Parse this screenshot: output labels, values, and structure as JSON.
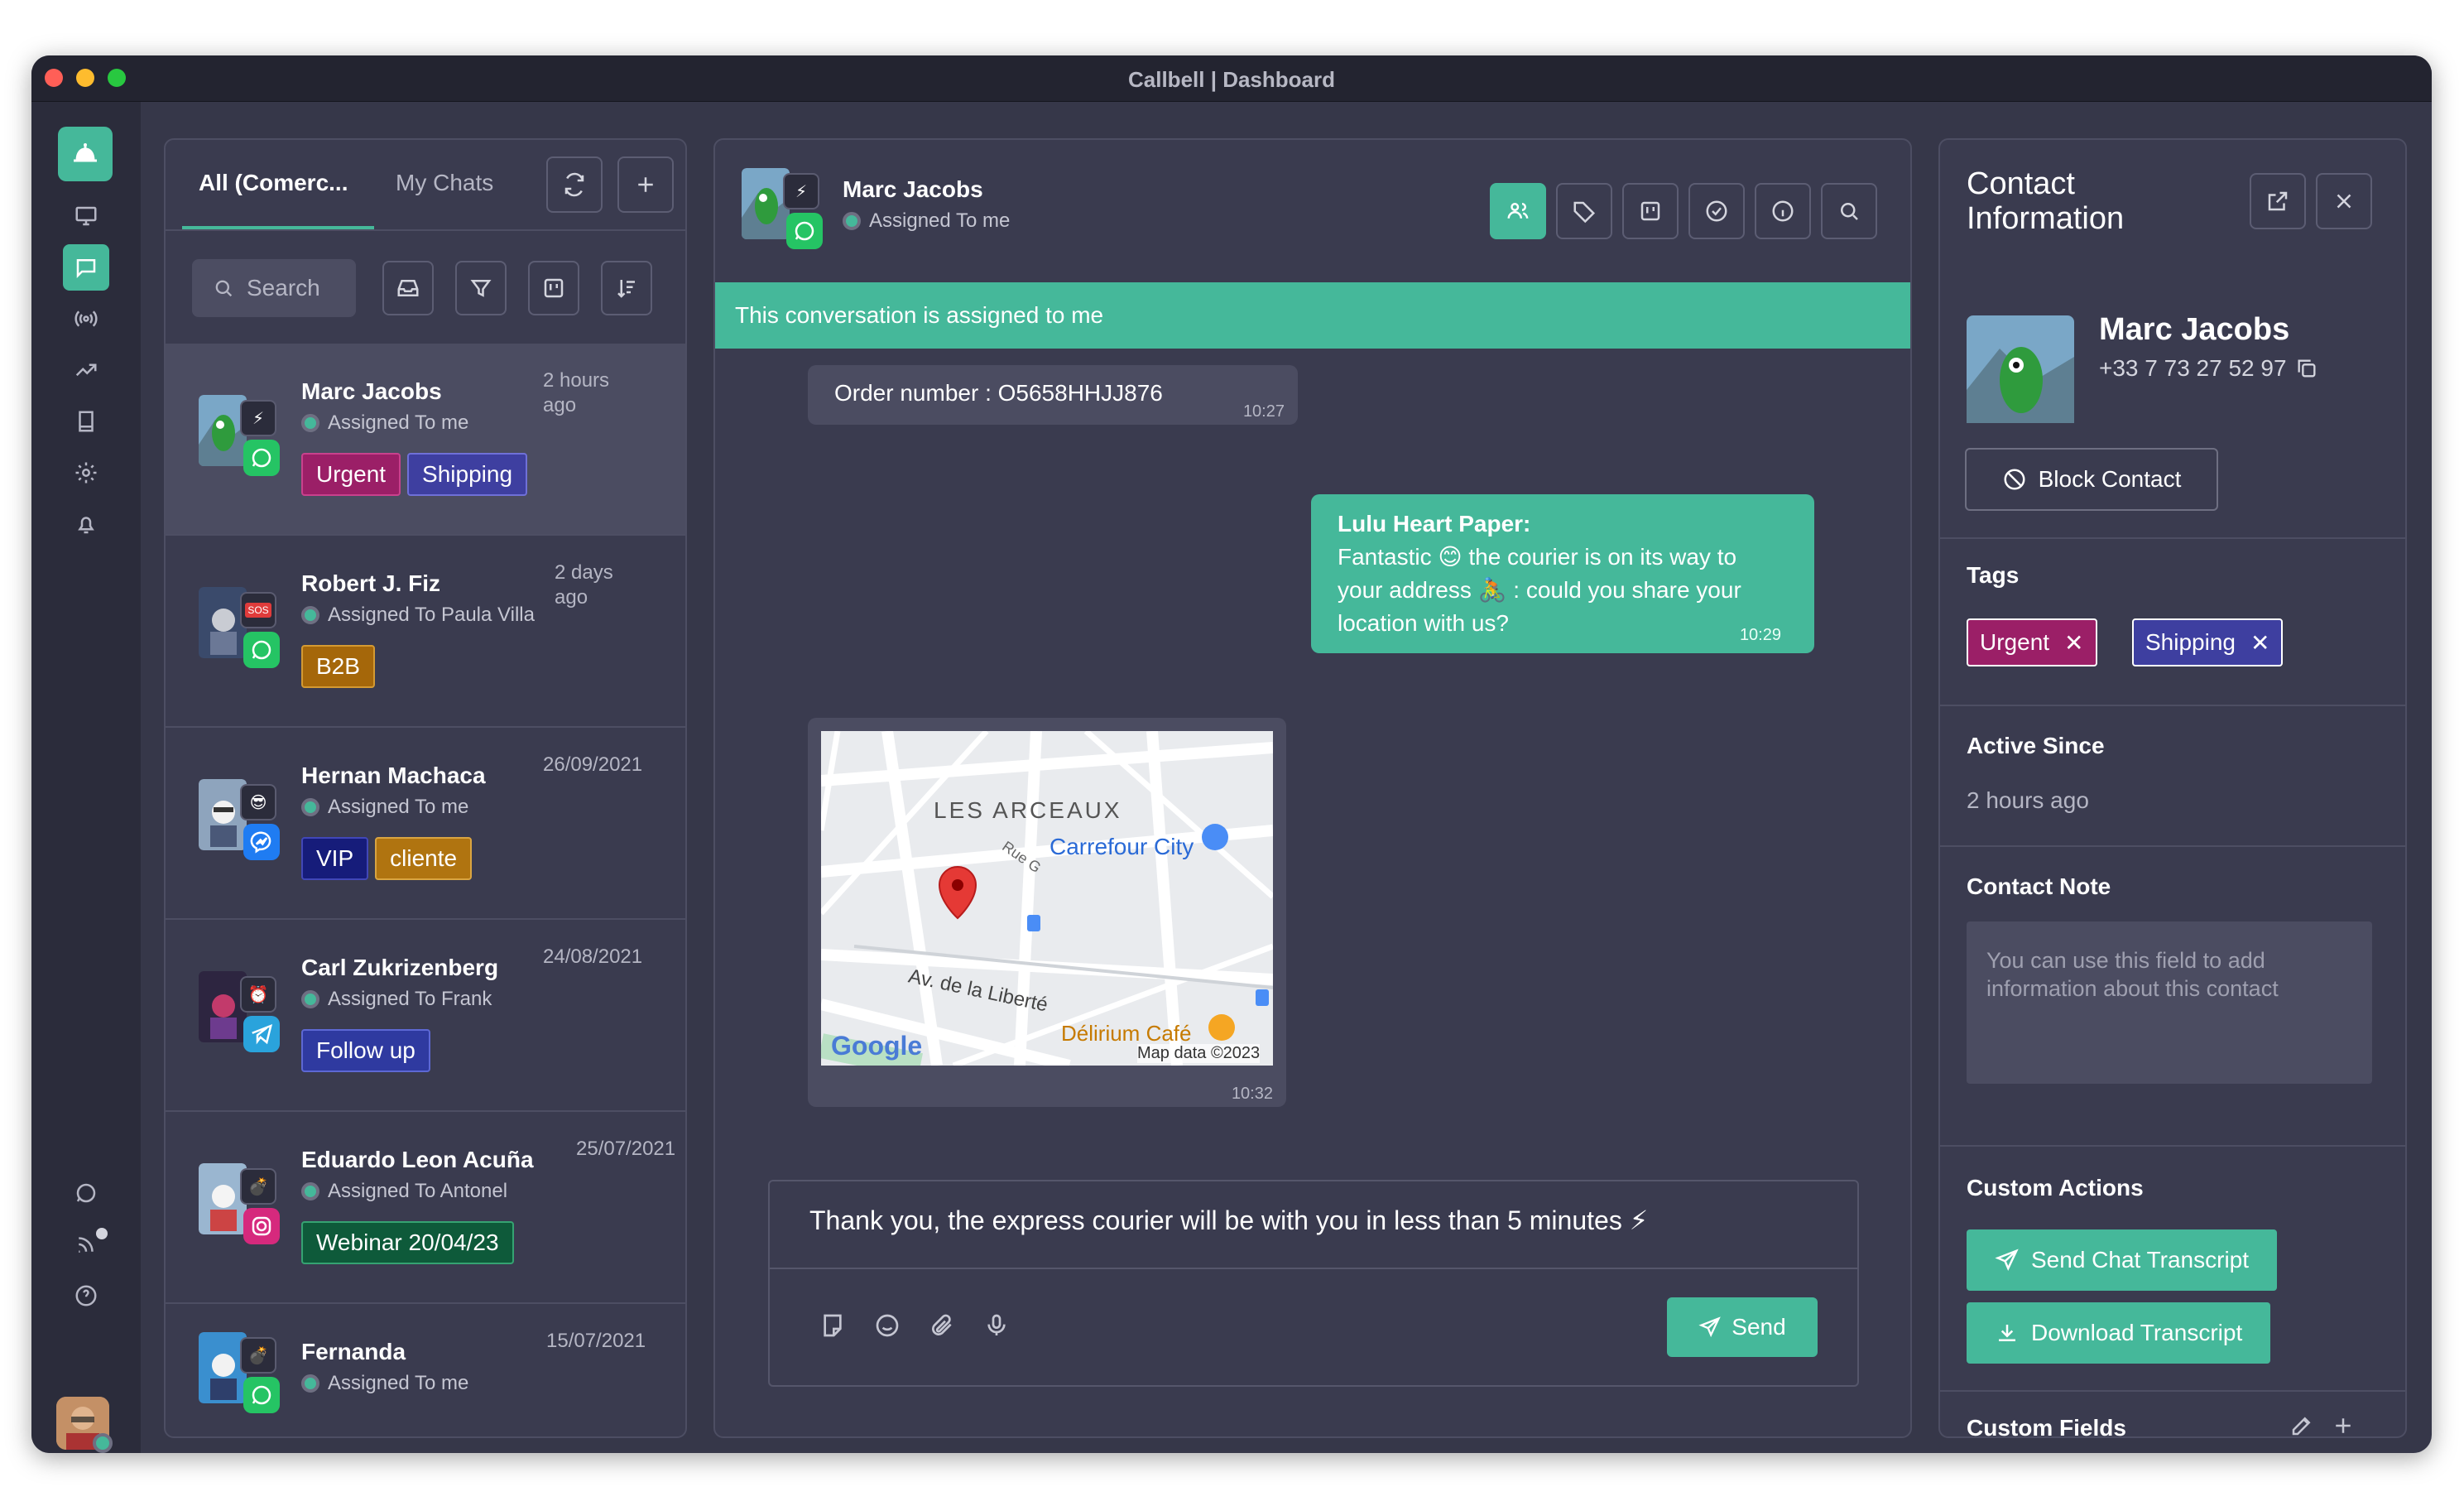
{
  "window": {
    "title": "Callbell | Dashboard"
  },
  "colors": {
    "accent": "#45b89a",
    "background": "#363749",
    "panel": "#3a3b4f",
    "rail": "#2b2c3b"
  },
  "sidebar": {
    "icons": [
      "bell-logo-icon",
      "monitor-icon",
      "chat-icon",
      "broadcast-icon",
      "trend-icon",
      "book-icon",
      "gear-icon",
      "bell-icon",
      "whatsapp-icon",
      "rss-icon",
      "help-icon"
    ],
    "active": "chat-icon"
  },
  "list": {
    "tabs": [
      "All (Comerc...",
      "My Chats"
    ],
    "search_placeholder": "Search",
    "conversations": [
      {
        "name": "Marc Jacobs",
        "assigned": "Assigned To me",
        "time": "2 hours ago",
        "tags": [
          "Urgent",
          "Shipping"
        ],
        "channel": "whatsapp"
      },
      {
        "name": "Robert J. Fiz",
        "assigned": "Assigned To Paula Villa",
        "time": "2 days ago",
        "tags": [
          "B2B"
        ],
        "channel": "whatsapp"
      },
      {
        "name": "Hernan Machaca",
        "assigned": "Assigned To me",
        "time": "26/09/2021",
        "tags": [
          "VIP",
          "cliente"
        ],
        "channel": "messenger"
      },
      {
        "name": "Carl Zukrizenberg",
        "assigned": "Assigned To Frank",
        "time": "24/08/2021",
        "tags": [
          "Follow up"
        ],
        "channel": "telegram"
      },
      {
        "name": "Eduardo Leon Acuña",
        "assigned": "Assigned To Antonella",
        "time": "25/07/2021",
        "tags": [
          "Webinar 20/04/23"
        ],
        "channel": "instagram"
      },
      {
        "name": "Fernanda",
        "assigned": "Assigned To me",
        "time": "15/07/2021",
        "tags": [],
        "channel": "whatsapp"
      }
    ]
  },
  "chat": {
    "contact_name": "Marc Jacobs",
    "assigned": "Assigned To me",
    "banner": "This conversation is assigned to me",
    "messages": {
      "order": {
        "text": "Order number : O5658HHJJ876",
        "time": "10:27"
      },
      "agent": {
        "author": "Lulu Heart Paper:",
        "line1": "Fantastic 😊 the courier is on its way to",
        "line2": "your address 🚴 : could you share your",
        "line3": "location with us?",
        "time": "10:29"
      },
      "map": {
        "time": "10:32",
        "area": "LES ARCEAUX",
        "place1": "Carrefour City",
        "street": "Av. de la Liberté",
        "place2": "Délirium Café",
        "street2": "Rue G",
        "brand": "Google",
        "credit": "Map data ©2023"
      }
    },
    "composer": {
      "text": "Thank you, the express courier will be with you in less than 5 minutes ⚡",
      "send": "Send"
    }
  },
  "info": {
    "title": "Contact Information",
    "name": "Marc Jacobs",
    "phone": "+33 7 73 27 52 97",
    "block": "Block Contact",
    "tags_title": "Tags",
    "tags": [
      "Urgent",
      "Shipping"
    ],
    "active_title": "Active Since",
    "active_value": "2 hours ago",
    "note_title": "Contact Note",
    "note_placeholder": "You can use this field to add information about this contact",
    "actions_title": "Custom Actions",
    "action1": "Send Chat Transcript",
    "action2": "Download Transcript",
    "fields_title": "Custom Fields"
  }
}
